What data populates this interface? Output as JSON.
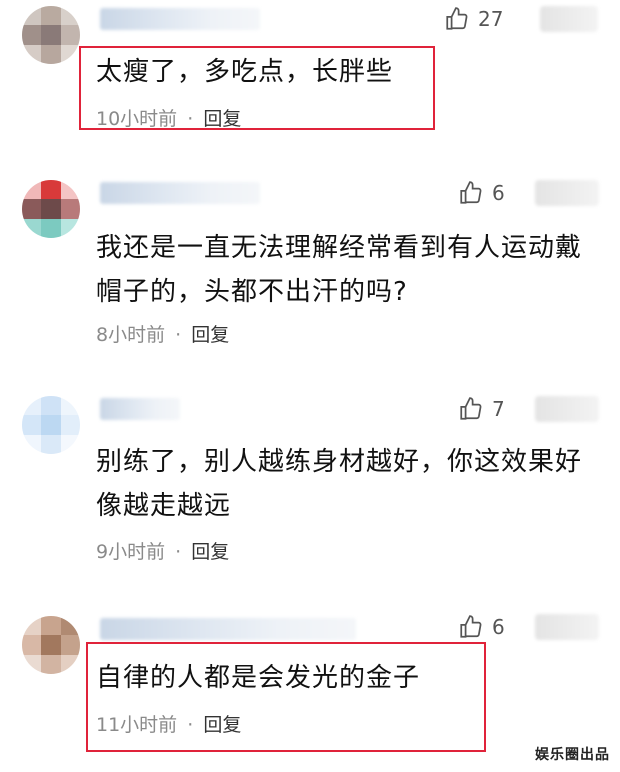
{
  "comments": [
    {
      "likes": "27",
      "text": "太瘦了，多吃点，长胖些",
      "time": "10小时前",
      "separator": "·",
      "reply": "回复"
    },
    {
      "likes": "6",
      "text": "我还是一直无法理解经常看到有人运动戴帽子的，头都不出汗的吗?",
      "time": "8小时前",
      "separator": "·",
      "reply": "回复"
    },
    {
      "likes": "7",
      "text": "别练了，别人越练身材越好，你这效果好像越走越远",
      "time": "9小时前",
      "separator": "·",
      "reply": "回复"
    },
    {
      "likes": "6",
      "text": "自律的人都是会发光的金子",
      "time": "11小时前",
      "separator": "·",
      "reply": "回复"
    }
  ],
  "watermark": "娱乐圈出品",
  "colors": {
    "highlight": "#e0233a",
    "meta": "#8a8a8a"
  },
  "icons": {
    "like": "thumbs-up-icon"
  }
}
